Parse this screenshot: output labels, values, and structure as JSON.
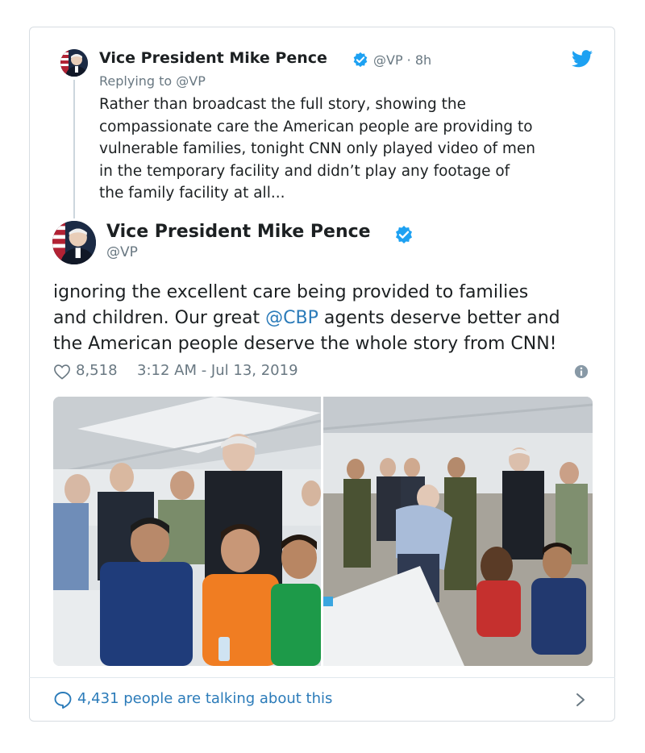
{
  "parent_tweet": {
    "author_name": "Vice President Mike Pence",
    "meta": "@VP · 8h",
    "replying_to": "Replying to @VP",
    "lines": [
      "Rather than broadcast the full story, showing the",
      "compassionate care the American people are providing to",
      "vulnerable families, tonight CNN only played video of men",
      "in the temporary facility and didn’t play any footage of",
      "the family facility at all..."
    ]
  },
  "main_tweet": {
    "author_name": "Vice President Mike Pence",
    "handle": "@VP",
    "text": {
      "line1": "ignoring the excellent care being provided to families",
      "line2_before": "and children. Our great ",
      "line2_mention": "@CBP",
      "line2_after": " agents deserve better and",
      "line3": "the American people deserve the whole story from CNN!"
    },
    "likes": "8,518",
    "timestamp": "3:12 AM - Jul 13, 2019"
  },
  "footer": {
    "talking_label": "4,431 people are talking about this"
  },
  "icons": {
    "verified": "verified-badge-icon",
    "twitter": "twitter-bird-icon",
    "heart": "heart-icon",
    "info": "info-icon",
    "reply": "speech-bubble-icon",
    "chevron": "chevron-right-icon"
  },
  "colors": {
    "link": "#2b7bb9",
    "verified": "#1da1f2",
    "muted": "#697882",
    "text": "#1c2022"
  }
}
